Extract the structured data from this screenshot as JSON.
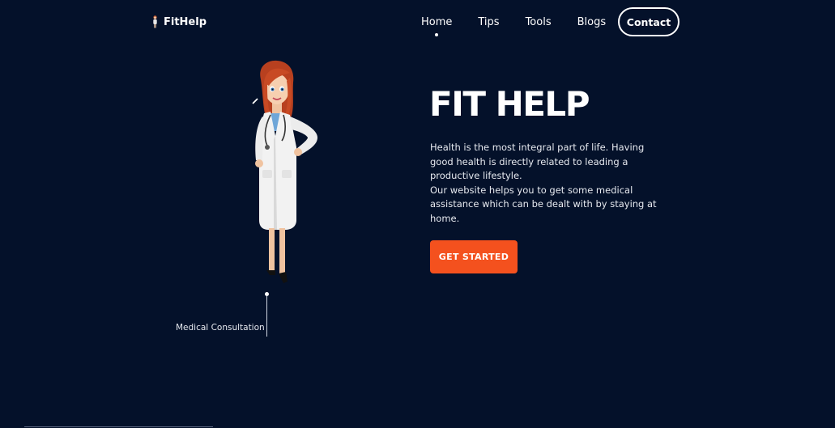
{
  "header": {
    "logo_text": "FitHelp",
    "logo_icon": "doctor-figure-icon",
    "nav": [
      {
        "label": "Home",
        "active": true
      },
      {
        "label": "Tips",
        "active": false
      },
      {
        "label": "Tools",
        "active": false
      },
      {
        "label": "Blogs",
        "active": false
      }
    ],
    "contact_label": "Contact"
  },
  "hero": {
    "title": "FIT HELP",
    "paragraph1": "Health is the most integral part of life. Having good health is directly related to leading a productive lifestyle.",
    "paragraph2": "Our website helps you to get some medical assistance which can be dealt with by staying at home.",
    "cta_label": "GET STARTED",
    "illustration": "doctor-illustration"
  },
  "annotation": {
    "label": "Medical Consultation"
  },
  "colors": {
    "background": "#04112a",
    "accent": "#f4511e",
    "text": "#ffffff"
  }
}
